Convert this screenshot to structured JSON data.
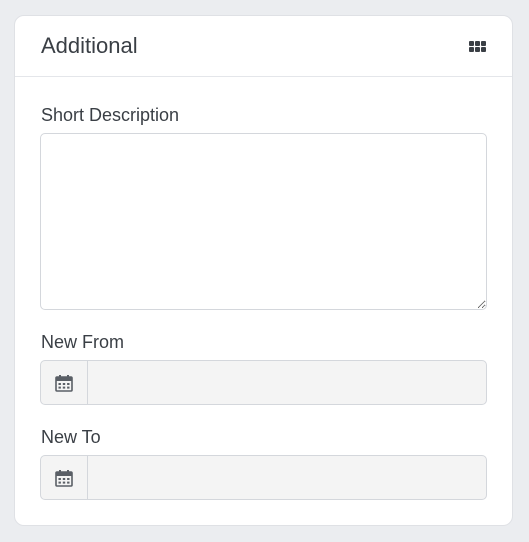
{
  "panel": {
    "title": "Additional",
    "menu_icon": "grid-icon"
  },
  "fields": {
    "short_description": {
      "label": "Short Description",
      "value": "",
      "placeholder": ""
    },
    "new_from": {
      "label": "New From",
      "value": "",
      "icon": "calendar-icon"
    },
    "new_to": {
      "label": "New To",
      "value": "",
      "icon": "calendar-icon"
    }
  },
  "colors": {
    "background": "#ebedf0",
    "card": "#ffffff",
    "text": "#3a3f45",
    "input_disabled_bg": "#f4f4f4",
    "border": "#d4d7dc"
  }
}
